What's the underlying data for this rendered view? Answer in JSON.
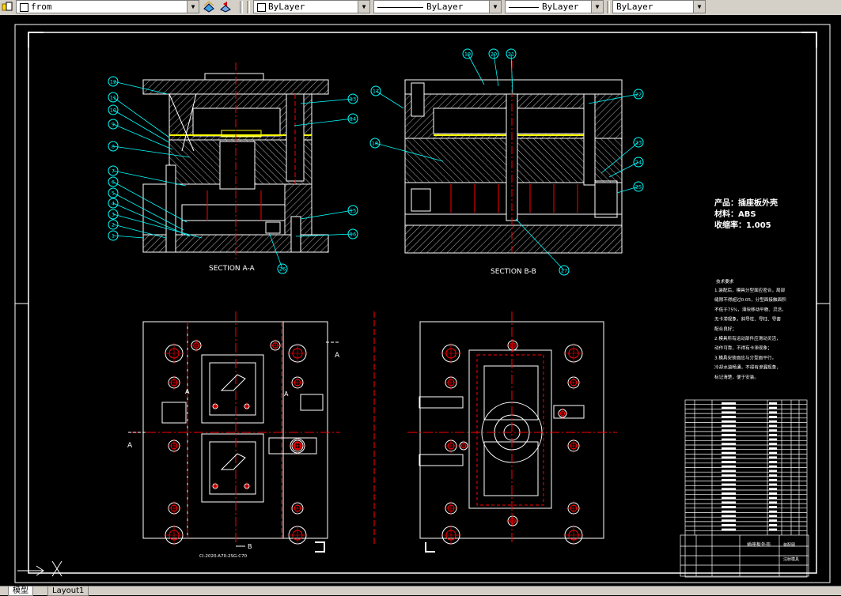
{
  "toolbar": {
    "layer_combo": {
      "value": "from",
      "icon": "layer-state-icons"
    },
    "color_combo": {
      "value": "ByLayer"
    },
    "linetype_combo": {
      "value": "ByLayer"
    },
    "lineweight_combo": {
      "value": "ByLayer"
    },
    "plotstyle_combo": {
      "value": "ByLayer"
    }
  },
  "drawing": {
    "section_aa_label": "SECTION A-A",
    "section_bb_label": "SECTION B-B",
    "product_label": "产品：插座板外壳",
    "material_label": "材料：ABS",
    "shrink_label": "收缩率：1.005",
    "tech_req_title": "技术要求",
    "tech_req_lines": [
      "1.装配后，模具分型面应密合，局部",
      "缝隙不得超过0.05，分型面接触面积",
      "不低于75%，滑块移动平稳、灵活，",
      "无卡滞现象，斜导柱、导柱、导套",
      "配合良好；",
      "2.模具所有运动部件应滑动灵活，",
      "动作可靠，不得有卡滞现象；",
      "3.模具安装面应与分型面平行，",
      "冷却水道畅通，不得有渗漏现象，",
      "标记清楚，便于安装。"
    ],
    "view_marker_a": "A",
    "view_marker_b": "B",
    "drawing_number": "CI-2020-A70-2SG-C70",
    "title_block_name": "插座板外壳",
    "title_block_type": "注射模具",
    "title_block_subtitle": "装配图",
    "balloons_left": [
      "12",
      "11",
      "10",
      "9",
      "8",
      "7",
      "6",
      "5",
      "4",
      "3",
      "2",
      "1",
      "13",
      "14",
      "15",
      "16",
      "26"
    ],
    "balloons_right": [
      "19",
      "20",
      "21",
      "17",
      "18",
      "22",
      "23",
      "24",
      "25",
      "27"
    ]
  },
  "tabs": {
    "model": "模型",
    "layout1": "Layout1"
  },
  "colors": {
    "outline": "#ffffff",
    "centerline": "#ff0000",
    "balloon": "#00ffff",
    "hatch": "#ffffff",
    "parting": "#ffff00",
    "background": "#000000"
  }
}
